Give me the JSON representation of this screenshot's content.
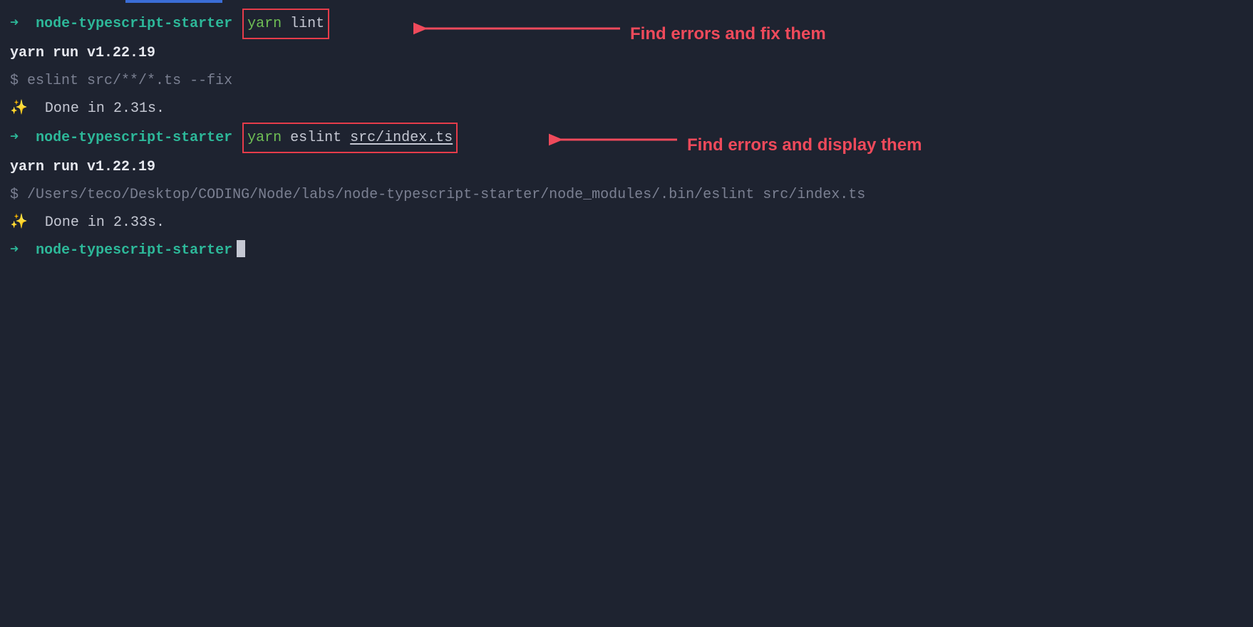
{
  "prompt": {
    "arrow": "➜",
    "dir": "node-typescript-starter"
  },
  "blocks": [
    {
      "cmd_yarn": "yarn",
      "cmd_rest": " lint",
      "yarn_version": "yarn run v1.22.19",
      "dollar": "$",
      "exec": "eslint src/**/*.ts --fix",
      "sparkle": "✨",
      "done": " Done in 2.31s.",
      "annotation": "Find errors and fix them"
    },
    {
      "cmd_yarn": "yarn",
      "cmd_rest_a": " eslint ",
      "cmd_rest_u": "src/index.ts",
      "yarn_version": "yarn run v1.22.19",
      "dollar": "$",
      "exec": "/Users/teco/Desktop/CODING/Node/labs/node-typescript-starter/node_modules/.bin/eslint src/index.ts",
      "sparkle": "✨",
      "done": " Done in 2.33s.",
      "annotation": "Find errors and display them"
    }
  ],
  "colors": {
    "bg": "#1e2330",
    "accent": "#2db899",
    "annotation": "#ef4a5b",
    "box": "#e63c4a"
  }
}
